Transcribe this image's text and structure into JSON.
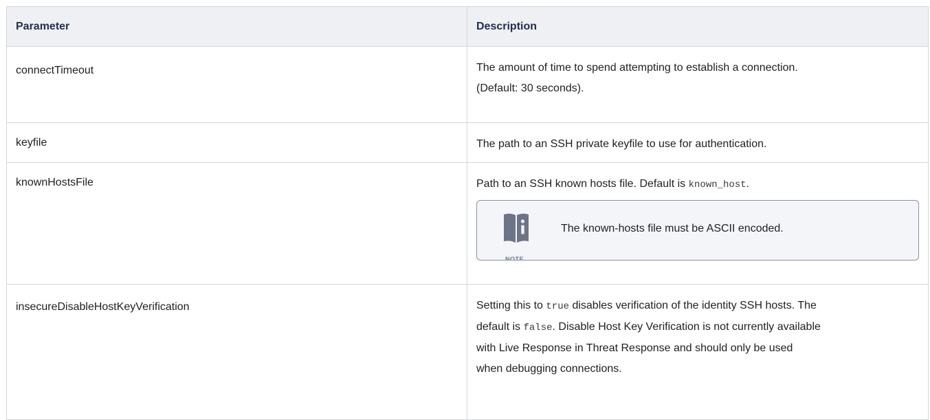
{
  "table": {
    "headers": {
      "parameter": "Parameter",
      "description": "Description"
    },
    "rows": [
      {
        "name": "connectTimeout",
        "desc_line1": "The amount of time to spend attempting to establish a connection.",
        "desc_line2": "(Default: 30 seconds)."
      },
      {
        "name": "keyfile",
        "desc_line1": "The path to an SSH private keyfile to use for authentication."
      },
      {
        "name": "knownHostsFile",
        "desc_pre": "Path to an SSH known hosts file. Default is ",
        "desc_code": "known_host",
        "desc_post": ".",
        "note": {
          "label": "NOTE",
          "text": "The known-hosts file must be ASCII encoded.",
          "icon": "book-info-icon"
        }
      },
      {
        "name": "insecureDisableHostKeyVerification",
        "seg1": "Setting this to ",
        "code1": "true",
        "seg2": " disables verification of the identity SSH hosts. The",
        "seg3": "default is ",
        "code2": "false",
        "seg4": ". Disable Host Key Verification is not currently available",
        "seg5": "with Live Response in Threat Response and should only be used",
        "seg6": "when debugging connections."
      }
    ]
  },
  "colors": {
    "header_bg": "#eef0f4",
    "border": "#d3d6dc",
    "note_border": "#8b91a3",
    "note_icon": "#6d7487"
  }
}
